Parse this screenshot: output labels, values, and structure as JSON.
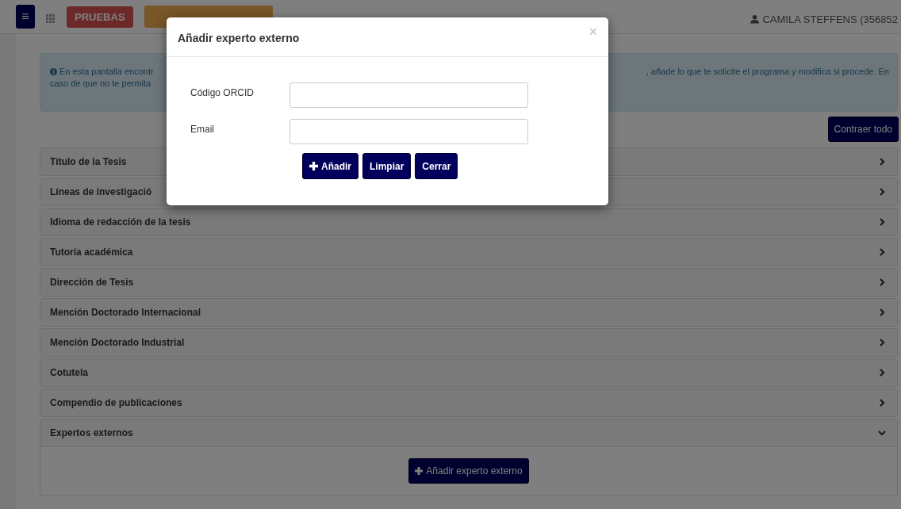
{
  "navbar": {
    "menu_button": "≡",
    "env_badge": "PRUEBAS",
    "user": "CAMILA STEFFENS (356852"
  },
  "info": {
    "left_lines": [
      "En esta pantalla encontr",
      "caso de que no te permita"
    ],
    "right_text": ", añade lo que te solicite el programa y modifica si procede. En"
  },
  "collapse_button": "Contraer todo",
  "sections": [
    {
      "title": "Título de la Tesis",
      "expanded": false
    },
    {
      "title": "Líneas de investigació",
      "expanded": false
    },
    {
      "title": "Idioma de redacción de la tesis",
      "expanded": false
    },
    {
      "title": "Tutoría académica",
      "expanded": false
    },
    {
      "title": "Dirección de Tesis",
      "expanded": false
    },
    {
      "title": "Mención Doctorado Internacional",
      "expanded": false
    },
    {
      "title": "Mención Doctorado Industrial",
      "expanded": false
    },
    {
      "title": "Cotutela",
      "expanded": false
    },
    {
      "title": "Compendio de publicaciones",
      "expanded": false
    },
    {
      "title": "Expertos externos",
      "expanded": true,
      "button": "Añadir experto externo"
    }
  ],
  "modal": {
    "title": "Añadir experto externo",
    "close": "×",
    "fields": [
      {
        "label": "Código ORCID"
      },
      {
        "label": "Email"
      }
    ],
    "buttons": [
      {
        "label": "Añadir",
        "kind": "add"
      },
      {
        "label": "Limpiar",
        "kind": "plain"
      },
      {
        "label": "Cerrar",
        "kind": "plain"
      }
    ]
  }
}
